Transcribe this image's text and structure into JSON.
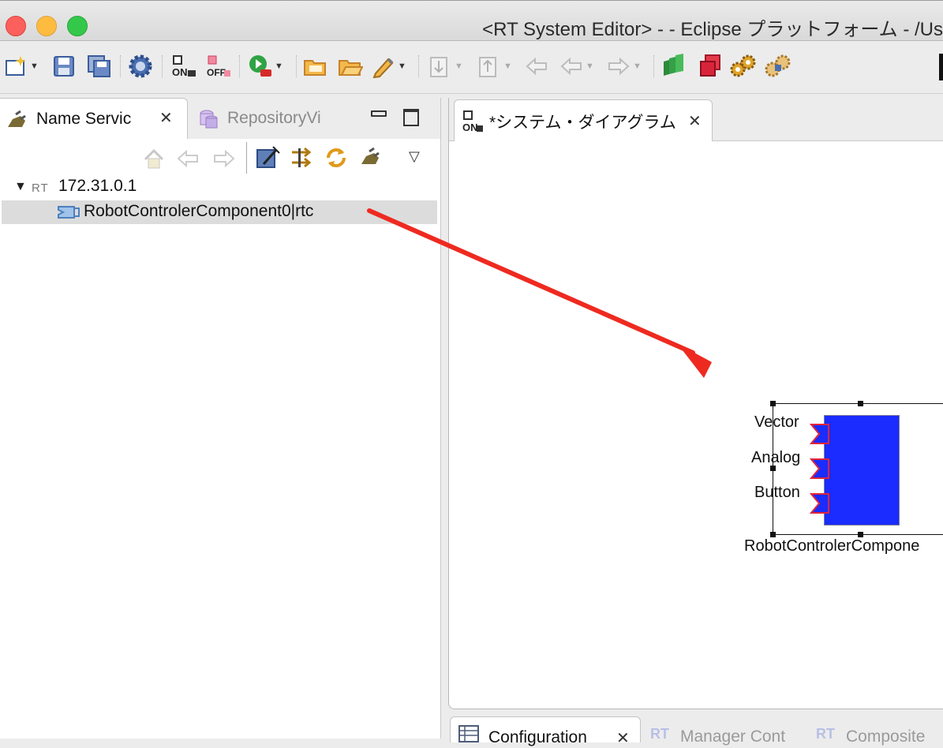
{
  "window": {
    "title": "<RT System Editor> -  - Eclipse プラットフォーム - /Us"
  },
  "toolbar": {
    "items": [
      "new-wizard-icon",
      "save-icon",
      "save-all-icon",
      "settings-gear-icon",
      "on-button-icon",
      "off-button-icon",
      "run-icon",
      "open-folder-icon",
      "open-project-icon",
      "pencil-tool-icon",
      "import-icon",
      "export-icon",
      "back-history-icon",
      "back-arrow-icon",
      "forward-arrow-icon",
      "activate-all-icon",
      "deactivate-all-icon",
      "start-all-icon",
      "stop-all-icon"
    ]
  },
  "left_view": {
    "tabs": [
      {
        "label": "Name Servic",
        "active": true
      },
      {
        "label": "RepositoryVi",
        "active": false
      }
    ],
    "tree": {
      "root_prefix": "RT",
      "root_label": "172.31.0.1",
      "child_label": "RobotControlerComponent0|rtc"
    }
  },
  "editor": {
    "tab_icon_text": "ON",
    "tab_label": "*システム・ダイアグラム",
    "component": {
      "name_label": "RobotControlerCompone",
      "ports": [
        "Vector",
        "Analog",
        "Button"
      ],
      "fill_color": "#1a2cff",
      "port_color": "#e0243c"
    }
  },
  "annotation": {
    "arrow_color": "#ee2a20"
  },
  "bottom_tabs": [
    {
      "label": "Configuration"
    },
    {
      "label": "Manager Cont"
    },
    {
      "label": "Composite"
    }
  ],
  "misc": {
    "on_text": "ON",
    "off_text": "OFF",
    "rt_badge": "RT"
  }
}
